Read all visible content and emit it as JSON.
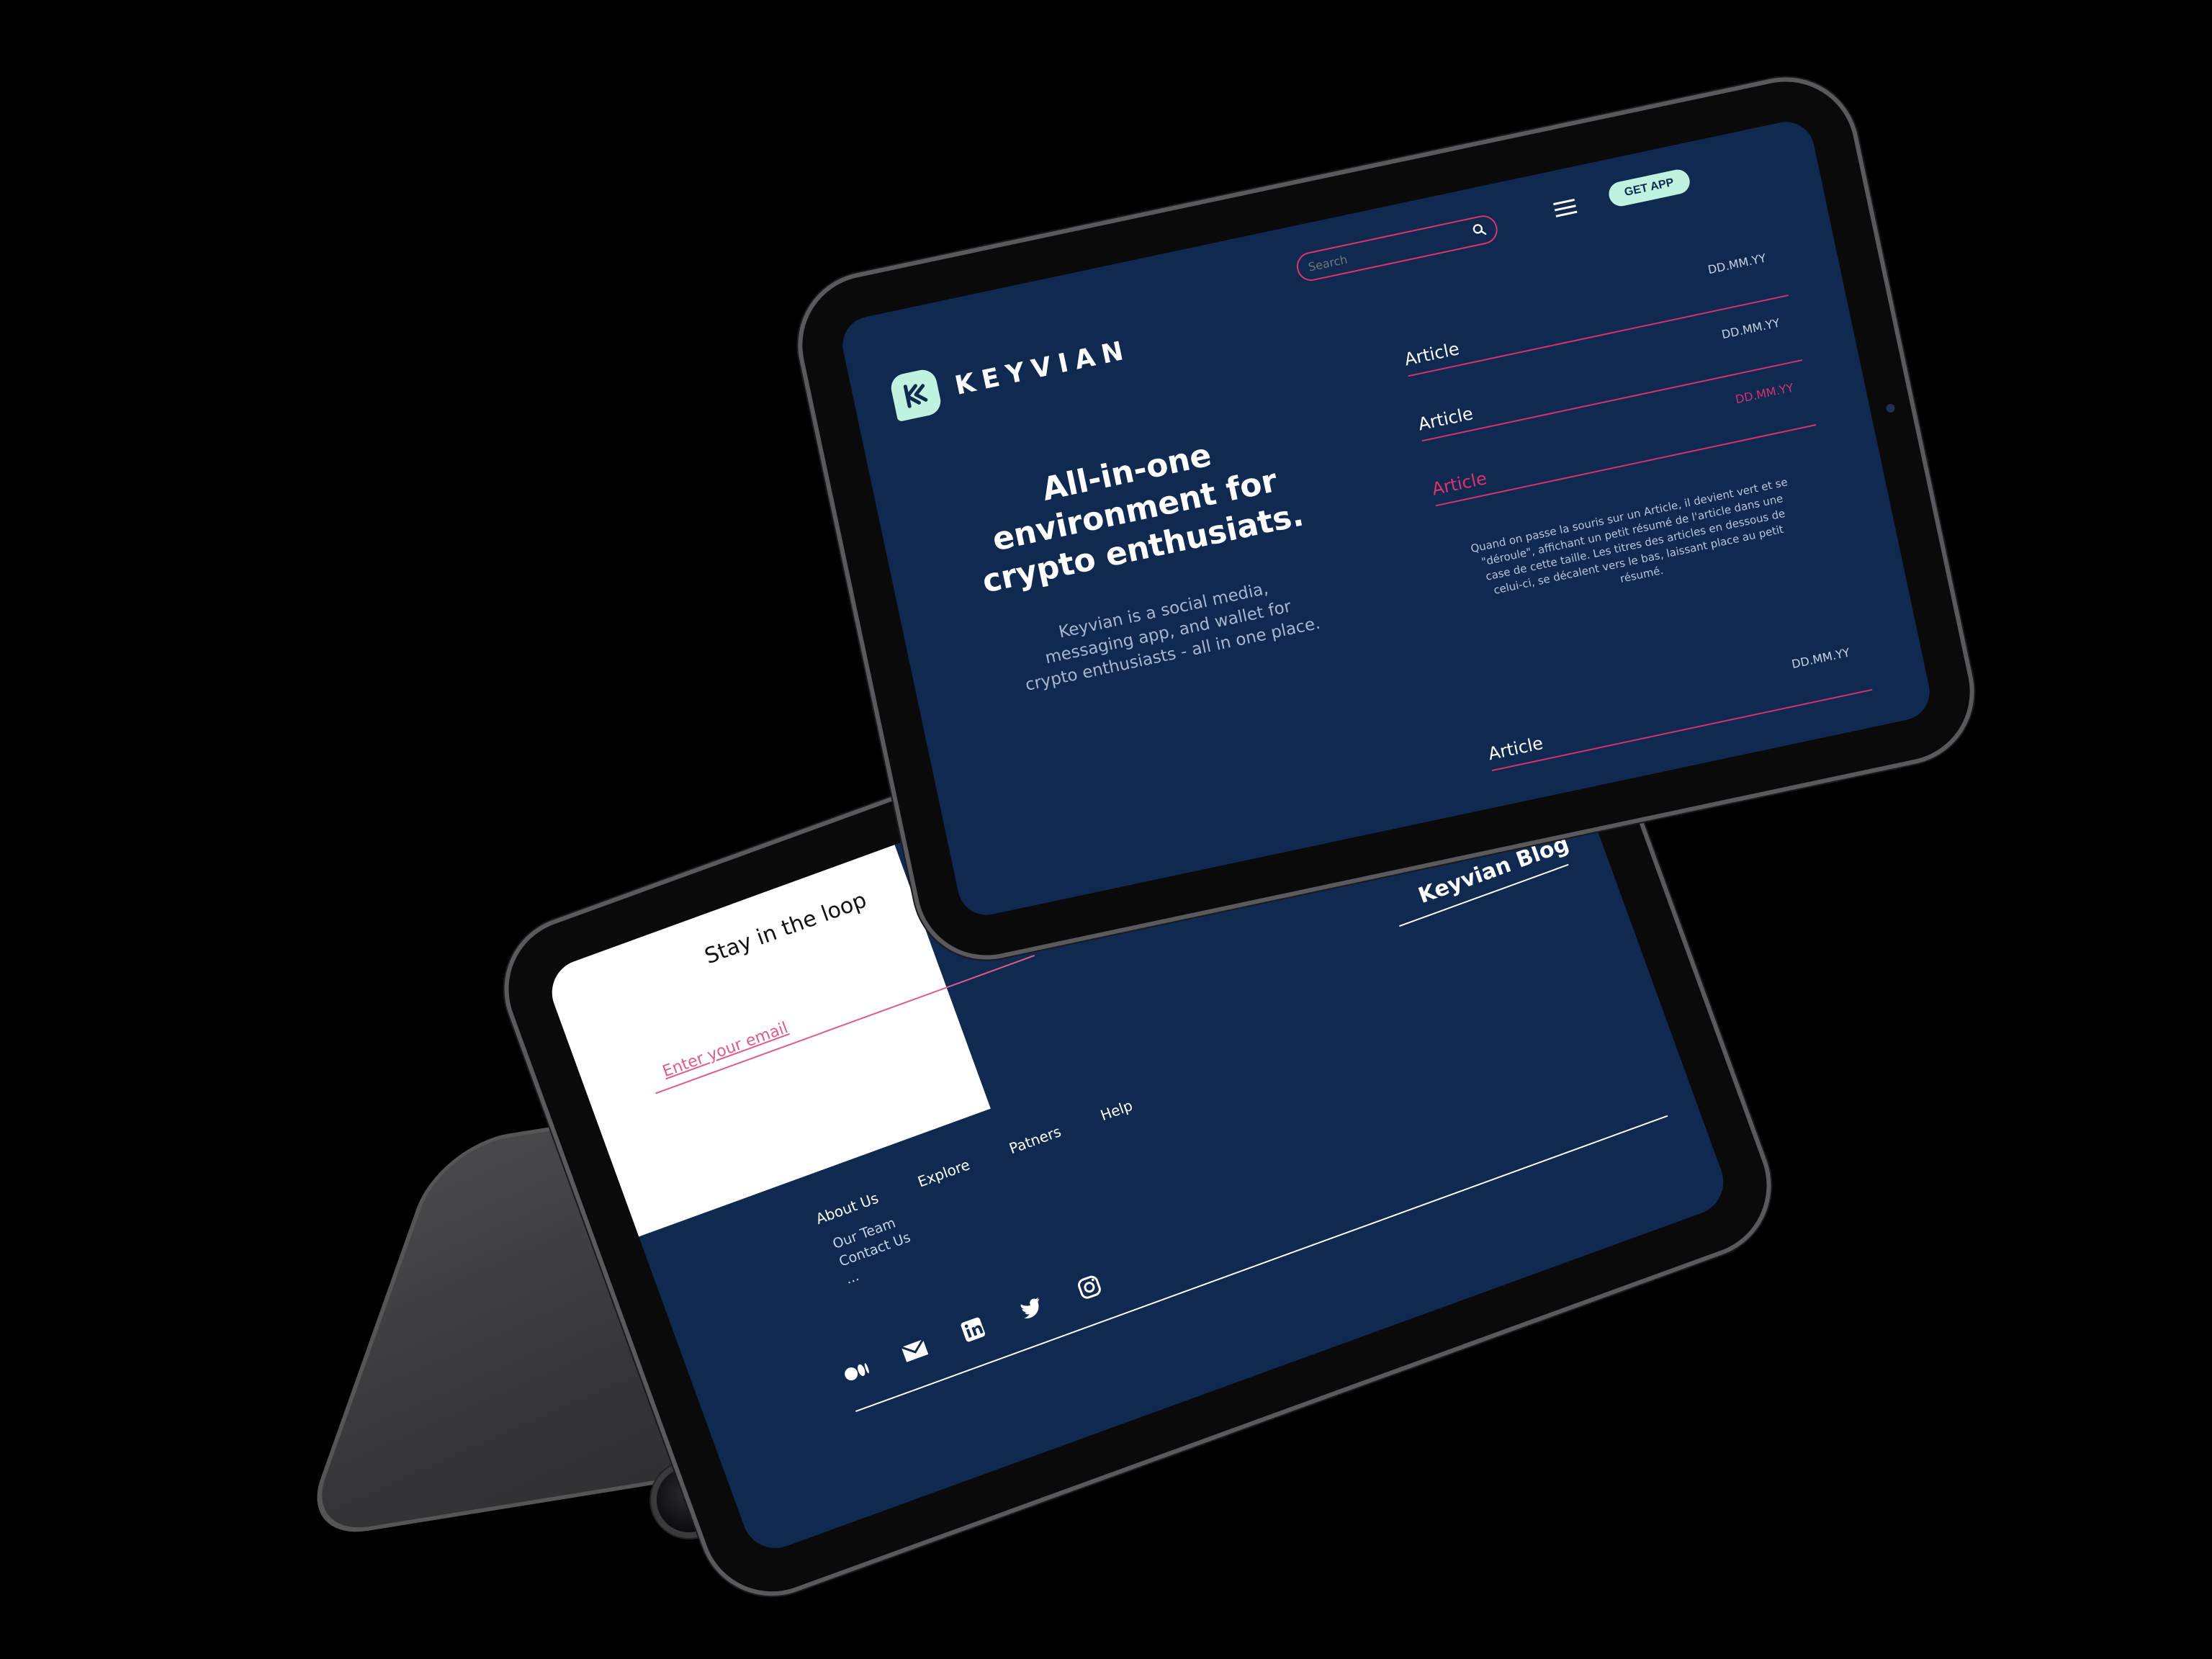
{
  "hero": {
    "brand": "KEYVIAN",
    "search_placeholder": "Search",
    "get_app_label": "GET APP",
    "title_line1": "All-in-one",
    "title_line2": "environment for",
    "title_line3": "crypto enthusiats.",
    "subtitle": "Keyvian is a social media, messaging app, and wallet for crypto enthusiasts - all in one place.",
    "articles": [
      {
        "title": "Article",
        "date": "DD.MM.YY"
      },
      {
        "title": "Article",
        "date": "DD.MM.YY"
      },
      {
        "title": "Article",
        "date": "DD.MM.YY",
        "active": true
      },
      {
        "title": "Article",
        "date": "DD.MM.YY"
      }
    ],
    "active_article_desc": "Quand on passe la souris sur un Article, il devient vert et se \"déroule\", affichant un petit résumé de l'article dans une case de cette taille. Les titres des articles en dessous de celui-ci, se décalent vers le bas, laissant place au petit résumé.",
    "accent_color": "#e0326b",
    "mint_color": "#bff3df",
    "navy_color": "#0f2951"
  },
  "footer": {
    "newsletter_title": "Stay in the loop",
    "email_placeholder": "Enter your email",
    "blog_title": "Keyvian Blog",
    "nav": [
      "About Us",
      "Explore",
      "Patners",
      "Help"
    ],
    "about_sub": [
      "Our Team",
      "Contact Us",
      "..."
    ],
    "socials": [
      "medium-icon",
      "mail-icon",
      "linkedin-icon",
      "twitter-icon",
      "instagram-icon"
    ]
  }
}
